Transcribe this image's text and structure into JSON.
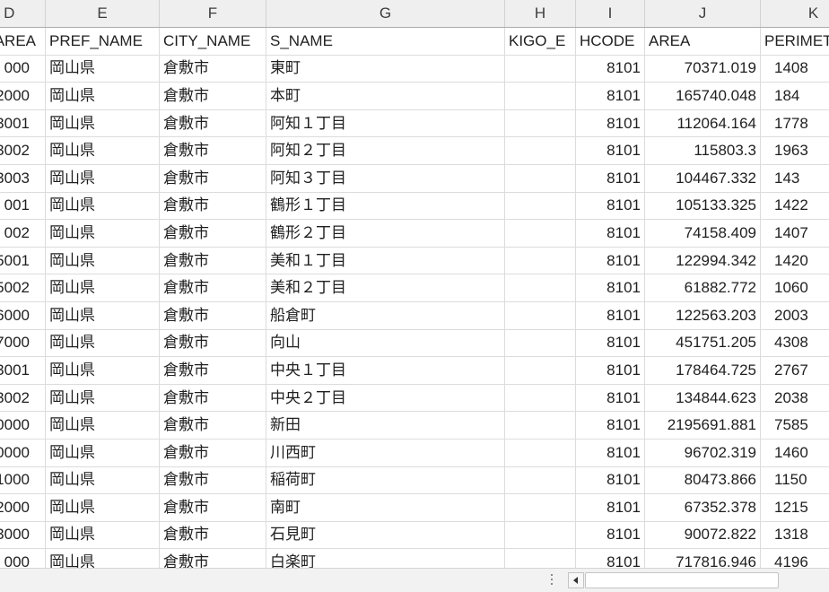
{
  "column_letters": [
    "D",
    "E",
    "F",
    "G",
    "H",
    "I",
    "J",
    "K"
  ],
  "field_headers": [
    "AREA",
    "PREF_NAME",
    "CITY_NAME",
    "S_NAME",
    "KIGO_E",
    "HCODE",
    "AREA",
    "PERIMET"
  ],
  "rows": [
    [
      "000",
      "岡山県",
      "倉敷市",
      "東町",
      "",
      "8101",
      "70371.019",
      "1408"
    ],
    [
      "2000",
      "岡山県",
      "倉敷市",
      "本町",
      "",
      "8101",
      "165740.048",
      "184"
    ],
    [
      "3001",
      "岡山県",
      "倉敷市",
      "阿知１丁目",
      "",
      "8101",
      "112064.164",
      "1778"
    ],
    [
      "3002",
      "岡山県",
      "倉敷市",
      "阿知２丁目",
      "",
      "8101",
      "115803.3",
      "1963"
    ],
    [
      "3003",
      "岡山県",
      "倉敷市",
      "阿知３丁目",
      "",
      "8101",
      "104467.332",
      "143"
    ],
    [
      "001",
      "岡山県",
      "倉敷市",
      "鶴形１丁目",
      "",
      "8101",
      "105133.325",
      "1422"
    ],
    [
      "002",
      "岡山県",
      "倉敷市",
      "鶴形２丁目",
      "",
      "8101",
      "74158.409",
      "1407"
    ],
    [
      "5001",
      "岡山県",
      "倉敷市",
      "美和１丁目",
      "",
      "8101",
      "122994.342",
      "1420"
    ],
    [
      "5002",
      "岡山県",
      "倉敷市",
      "美和２丁目",
      "",
      "8101",
      "61882.772",
      "1060"
    ],
    [
      "6000",
      "岡山県",
      "倉敷市",
      "船倉町",
      "",
      "8101",
      "122563.203",
      "2003"
    ],
    [
      "7000",
      "岡山県",
      "倉敷市",
      "向山",
      "",
      "8101",
      "451751.205",
      "4308"
    ],
    [
      "3001",
      "岡山県",
      "倉敷市",
      "中央１丁目",
      "",
      "8101",
      "178464.725",
      "2767"
    ],
    [
      "3002",
      "岡山県",
      "倉敷市",
      "中央２丁目",
      "",
      "8101",
      "134844.623",
      "2038"
    ],
    [
      "0000",
      "岡山県",
      "倉敷市",
      "新田",
      "",
      "8101",
      "2195691.881",
      "7585"
    ],
    [
      "0000",
      "岡山県",
      "倉敷市",
      "川西町",
      "",
      "8101",
      "96702.319",
      "1460"
    ],
    [
      "1000",
      "岡山県",
      "倉敷市",
      "稲荷町",
      "",
      "8101",
      "80473.866",
      "1150"
    ],
    [
      "2000",
      "岡山県",
      "倉敷市",
      "南町",
      "",
      "8101",
      "67352.378",
      "1215"
    ],
    [
      "3000",
      "岡山県",
      "倉敷市",
      "石見町",
      "",
      "8101",
      "90072.822",
      "1318"
    ],
    [
      "000",
      "岡山県",
      "倉敷市",
      "白楽町",
      "",
      "8101",
      "717816.946",
      "4196"
    ]
  ],
  "bottom_bar": {
    "splitter_icon": "vertical-dots-icon",
    "scroll_left_icon": "chevron-left-icon"
  },
  "colors": {
    "grid_line": "#dcdcdc",
    "header_background": "#efefef",
    "bar_background": "#f2f2f2"
  }
}
